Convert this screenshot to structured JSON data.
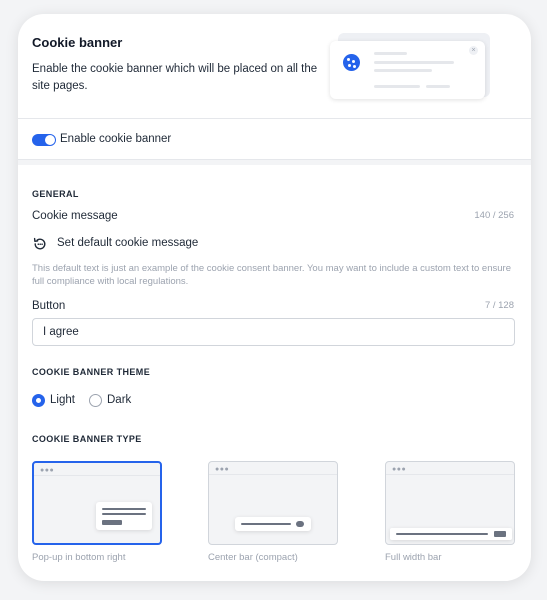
{
  "header": {
    "title": "Cookie banner",
    "description": "Enable the cookie banner which will be placed on all the site pages."
  },
  "enable_toggle": {
    "label": "Enable cookie banner",
    "checked": true,
    "color": "#2563eb"
  },
  "general": {
    "heading": "GENERAL",
    "cookie_message_label": "Cookie message",
    "cookie_message_counter": "140 / 256",
    "set_default_label": "Set default cookie message",
    "set_default_icon": "reset-icon",
    "hint": "This default text is just an example of the cookie consent banner. You may want to include a custom text to ensure full compliance with local regulations.",
    "button_label": "Button",
    "button_counter": "7 / 128",
    "button_value": "I agree"
  },
  "theme": {
    "heading": "COOKIE BANNER THEME",
    "options": [
      "Light",
      "Dark"
    ],
    "selected": "Light"
  },
  "banner_type": {
    "heading": "COOKIE BANNER TYPE",
    "options": [
      "Pop-up in bottom right",
      "Center bar (compact)",
      "Full width bar"
    ],
    "selected": "Pop-up in bottom right"
  },
  "colors": {
    "accent": "#2563eb",
    "muted_text": "#9ca3af"
  }
}
